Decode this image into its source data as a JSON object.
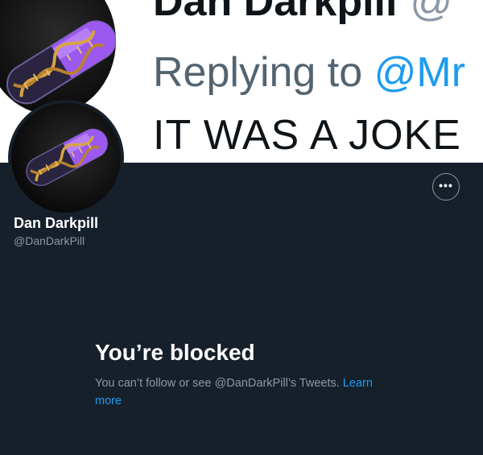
{
  "banner": {
    "line1_name": "Dan Darkpill",
    "line1_at": "@",
    "replying_prefix": "Replying to ",
    "replying_mention": "@Mr",
    "quote": "IT WAS A JOKE"
  },
  "profile": {
    "display_name": "Dan Darkpill",
    "handle": "@DanDarkPill",
    "avatar_icon": "dna-pill-icon",
    "more_icon": "more-options-icon"
  },
  "blocked": {
    "title": "You’re blocked",
    "description": "You can’t follow or see @DanDarkPill’s Tweets.",
    "learn_more_label": "Learn more"
  },
  "colors": {
    "background": "#15202b",
    "accent": "#1d9bf0",
    "muted": "#8b98a5"
  }
}
